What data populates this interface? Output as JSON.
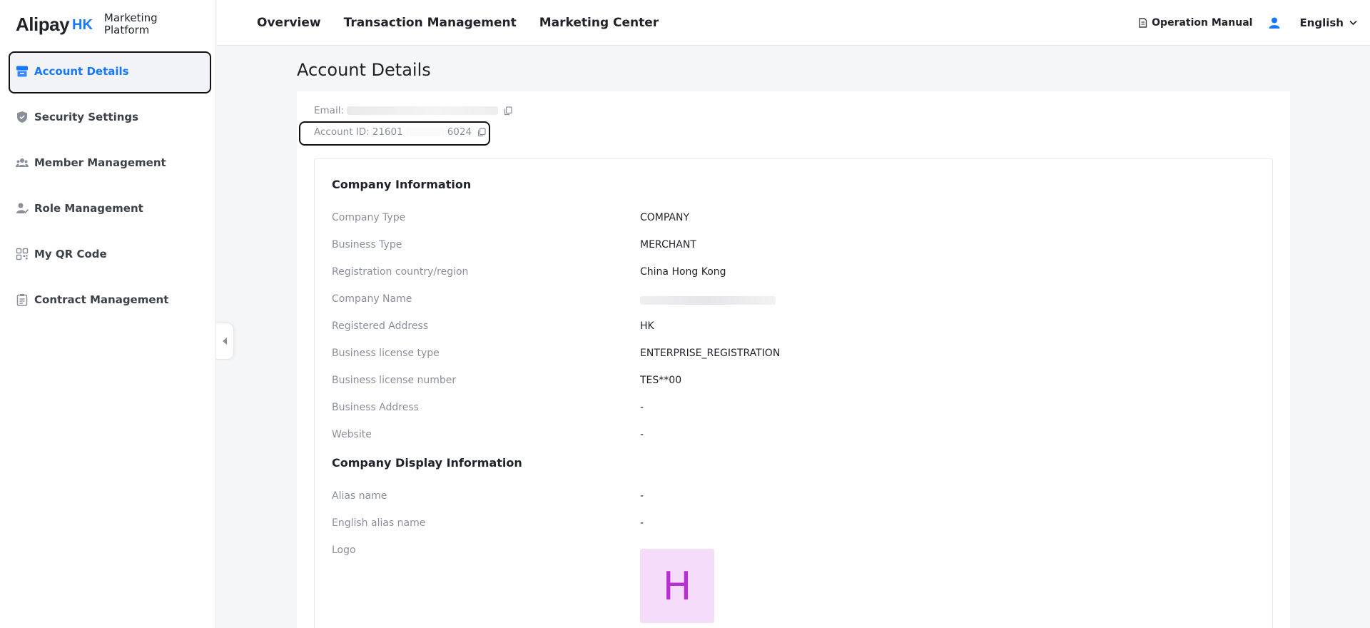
{
  "logo": {
    "brand": "Alipay",
    "region": "HK",
    "product_line1": "Marketing",
    "product_line2": "Platform"
  },
  "sidebar": {
    "items": [
      {
        "label": "Account Details",
        "icon": "store-icon",
        "active": true
      },
      {
        "label": "Security Settings",
        "icon": "shield-icon",
        "active": false
      },
      {
        "label": "Member Management",
        "icon": "members-icon",
        "active": false
      },
      {
        "label": "Role Management",
        "icon": "role-icon",
        "active": false
      },
      {
        "label": "My QR Code",
        "icon": "qr-code-icon",
        "active": false
      },
      {
        "label": "Contract Management",
        "icon": "clipboard-icon",
        "active": false
      }
    ]
  },
  "topnav": {
    "items": [
      "Overview",
      "Transaction Management",
      "Marketing Center"
    ]
  },
  "header": {
    "manual": "Operation Manual",
    "language": "English"
  },
  "page": {
    "title": "Account Details"
  },
  "account": {
    "email_label": "Email:",
    "account_id_label": "Account ID:",
    "account_id_prefix": "21601",
    "account_id_suffix": "6024"
  },
  "company_info": {
    "title": "Company Information",
    "rows": [
      {
        "label": "Company Type",
        "value": "COMPANY"
      },
      {
        "label": "Business Type",
        "value": "MERCHANT"
      },
      {
        "label": "Registration country/region",
        "value": "China Hong Kong"
      },
      {
        "label": "Company Name",
        "value": ""
      },
      {
        "label": "Registered Address",
        "value": "HK"
      },
      {
        "label": "Business license type",
        "value": "ENTERPRISE_REGISTRATION"
      },
      {
        "label": "Business license number",
        "value": "TES**00"
      },
      {
        "label": "Business Address",
        "value": "-"
      },
      {
        "label": "Website",
        "value": "-"
      }
    ]
  },
  "display_info": {
    "title": "Company Display Information",
    "rows": [
      {
        "label": "Alias name",
        "value": "-"
      },
      {
        "label": "English alias name",
        "value": "-"
      },
      {
        "label": "Logo",
        "value": ""
      }
    ],
    "logo_letter": "H"
  },
  "colors": {
    "accent": "#1677ff",
    "logo_bg": "#f6dcfb",
    "logo_fg": "#b62fd0"
  }
}
